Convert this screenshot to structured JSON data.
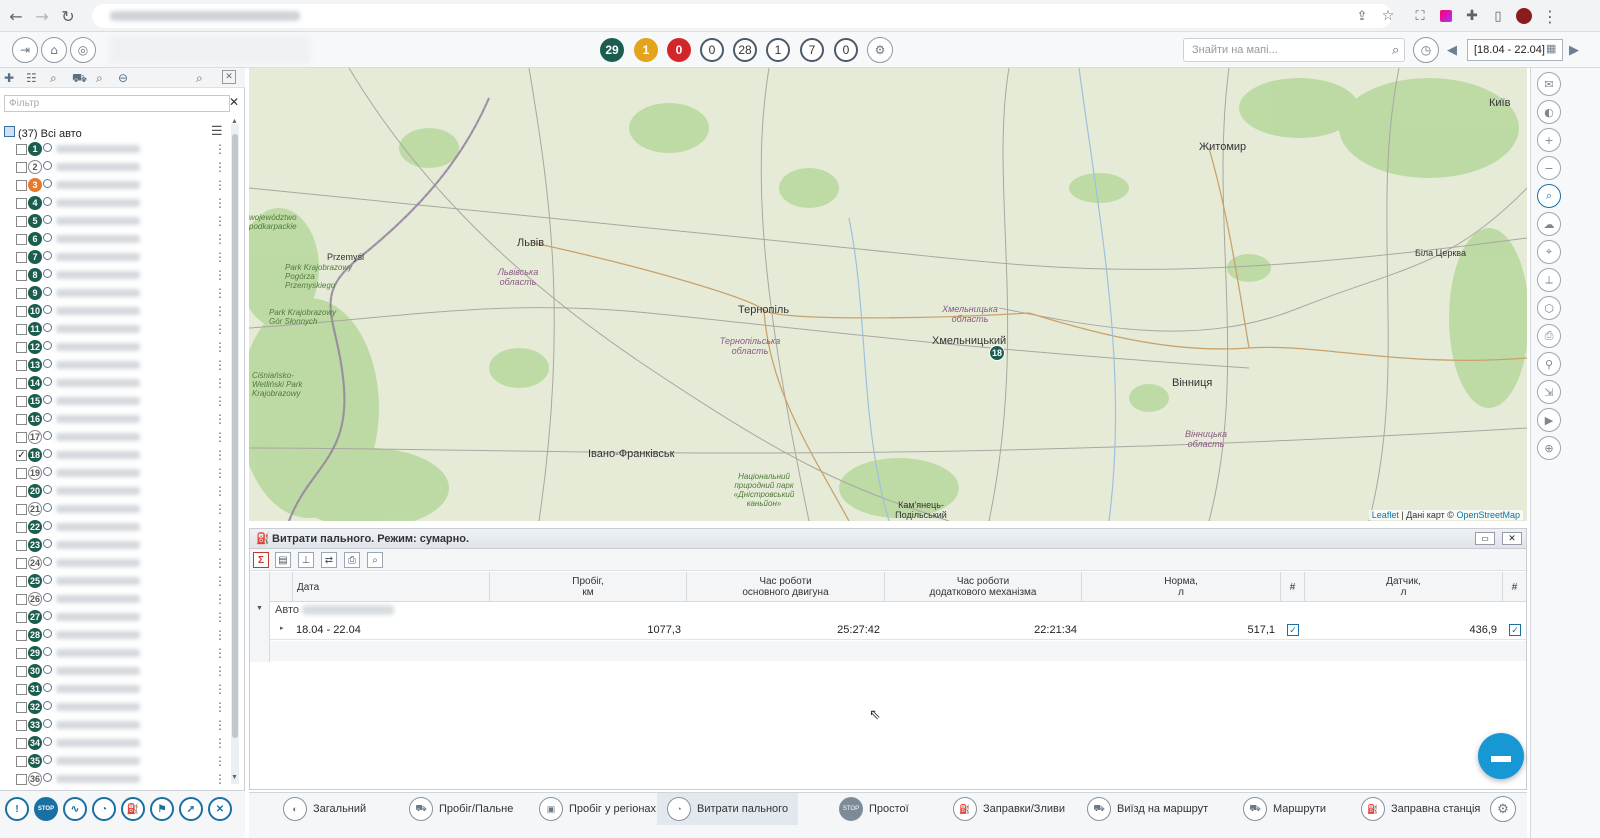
{
  "header": {
    "counters": [
      {
        "value": "29",
        "color": "#1b5e4f",
        "style": "filled"
      },
      {
        "value": "1",
        "color": "#e3a31b",
        "style": "filled"
      },
      {
        "value": "0",
        "color": "#d3262b",
        "style": "filled"
      },
      {
        "value": "0",
        "color": "#ffffff",
        "style": "outline"
      },
      {
        "value": "28",
        "color": "#ffffff",
        "style": "outline"
      },
      {
        "value": "1",
        "color": "#ffffff",
        "style": "outline"
      },
      {
        "value": "7",
        "color": "#ffffff",
        "style": "outline"
      },
      {
        "value": "0",
        "color": "#ffffff",
        "style": "outline"
      }
    ],
    "search_placeholder": "Знайти на мапі...",
    "date_range": "[18.04 - 22.04]"
  },
  "left": {
    "filter_placeholder": "Фільтр",
    "all_label": "(37) Всі авто",
    "vehicles": [
      {
        "n": "1",
        "c": "#1b5e4f"
      },
      {
        "n": "2",
        "c": "#ffffff"
      },
      {
        "n": "3",
        "c": "#e8782a"
      },
      {
        "n": "4",
        "c": "#1b5e4f"
      },
      {
        "n": "5",
        "c": "#1b5e4f"
      },
      {
        "n": "6",
        "c": "#1b5e4f"
      },
      {
        "n": "7",
        "c": "#1b5e4f"
      },
      {
        "n": "8",
        "c": "#1b5e4f"
      },
      {
        "n": "9",
        "c": "#1b5e4f"
      },
      {
        "n": "10",
        "c": "#1b5e4f"
      },
      {
        "n": "11",
        "c": "#1b5e4f"
      },
      {
        "n": "12",
        "c": "#1b5e4f"
      },
      {
        "n": "13",
        "c": "#1b5e4f"
      },
      {
        "n": "14",
        "c": "#1b5e4f"
      },
      {
        "n": "15",
        "c": "#1b5e4f"
      },
      {
        "n": "16",
        "c": "#1b5e4f"
      },
      {
        "n": "17",
        "c": "#ffffff"
      },
      {
        "n": "18",
        "c": "#1b5e4f",
        "checked": true
      },
      {
        "n": "19",
        "c": "#ffffff"
      },
      {
        "n": "20",
        "c": "#1b5e4f"
      },
      {
        "n": "21",
        "c": "#ffffff"
      },
      {
        "n": "22",
        "c": "#1b5e4f"
      },
      {
        "n": "23",
        "c": "#1b5e4f"
      },
      {
        "n": "24",
        "c": "#ffffff"
      },
      {
        "n": "25",
        "c": "#1b5e4f"
      },
      {
        "n": "26",
        "c": "#ffffff"
      },
      {
        "n": "27",
        "c": "#1b5e4f"
      },
      {
        "n": "28",
        "c": "#1b5e4f"
      },
      {
        "n": "29",
        "c": "#1b5e4f"
      },
      {
        "n": "30",
        "c": "#1b5e4f"
      },
      {
        "n": "31",
        "c": "#1b5e4f"
      },
      {
        "n": "32",
        "c": "#1b5e4f"
      },
      {
        "n": "33",
        "c": "#1b5e4f"
      },
      {
        "n": "34",
        "c": "#1b5e4f"
      },
      {
        "n": "35",
        "c": "#1b5e4f"
      },
      {
        "n": "36",
        "c": "#ffffff"
      }
    ]
  },
  "map": {
    "cities": [
      "Житомир",
      "Київ",
      "Львів",
      "Тернопіль",
      "Хмельницький",
      "Вінниця",
      "Івано-Франківськ",
      "Przemyśl",
      "Біла Церква",
      "Кам'янець-Подільський"
    ],
    "regions": [
      "Львівська область",
      "Тернопільська область",
      "Хмельницька область",
      "Вінницька область"
    ],
    "marker": "18",
    "attribution_link1": "Leaflet",
    "attribution_text": " | Дані карт © ",
    "attribution_link2": "OpenStreetMap"
  },
  "panel": {
    "title": "Витрати пального. Режим: сумарно.",
    "columns": {
      "date": "Дата",
      "mileage_1": "Пробіг,",
      "mileage_2": "км",
      "engine_1": "Час роботи",
      "engine_2": "основного двигуна",
      "aux_1": "Час роботи",
      "aux_2": "додаткового механізма",
      "norm_1": "Норма,",
      "norm_2": "л",
      "hash1": "#",
      "sensor_1": "Датчик,",
      "sensor_2": "л",
      "hash2": "#"
    },
    "group_label": "Авто",
    "row": {
      "date": "18.04 - 22.04",
      "mileage": "1077,3",
      "engine": "25:27:42",
      "aux": "22:21:34",
      "norm": "517,1",
      "sensor": "436,9"
    }
  },
  "tabs": [
    {
      "label": "Загальний"
    },
    {
      "label": "Пробіг/Пальне"
    },
    {
      "label": "Пробіг у регіонах"
    },
    {
      "label": "Витрати пального",
      "active": true
    },
    {
      "label": "Простої"
    },
    {
      "label": "Заправки/Зливи"
    },
    {
      "label": "Виїзд на маршрут"
    },
    {
      "label": "Маршрути"
    },
    {
      "label": "Заправна станція"
    }
  ]
}
